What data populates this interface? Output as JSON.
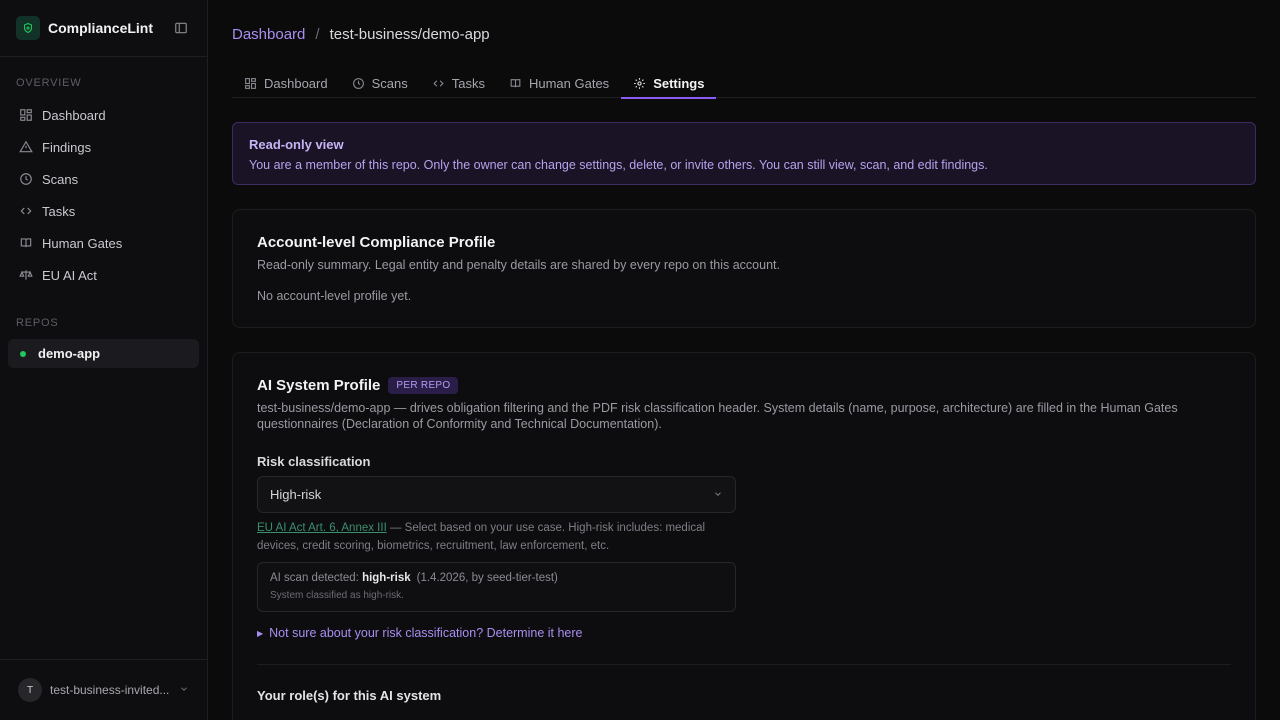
{
  "sidebar": {
    "brand": "ComplianceLint",
    "overview_label": "OVERVIEW",
    "items": [
      {
        "label": "Dashboard"
      },
      {
        "label": "Findings"
      },
      {
        "label": "Scans"
      },
      {
        "label": "Tasks"
      },
      {
        "label": "Human Gates"
      },
      {
        "label": "EU AI Act"
      }
    ],
    "repos_label": "REPOS",
    "repos": [
      {
        "label": "demo-app",
        "status_color": "#22c55e"
      }
    ],
    "user": {
      "initial": "T",
      "name": "test-business-invited..."
    }
  },
  "breadcrumb": {
    "root": "Dashboard",
    "separator": "/",
    "current": "test-business/demo-app"
  },
  "tabs": [
    {
      "label": "Dashboard"
    },
    {
      "label": "Scans"
    },
    {
      "label": "Tasks"
    },
    {
      "label": "Human Gates"
    },
    {
      "label": "Settings",
      "active": true
    }
  ],
  "notice": {
    "title": "Read-only view",
    "text": "You are a member of this repo. Only the owner can change settings, delete, or invite others. You can still view, scan, and edit findings."
  },
  "account_profile": {
    "title": "Account-level Compliance Profile",
    "subtitle": "Read-only summary. Legal entity and penalty details are shared by every repo on this account.",
    "empty": "No account-level profile yet."
  },
  "ai_profile": {
    "title": "AI System Profile",
    "badge": "PER REPO",
    "description": "test-business/demo-app — drives obligation filtering and the PDF risk classification header. System details (name, purpose, architecture) are filled in the Human Gates questionnaires (Declaration of Conformity and Technical Documentation).",
    "risk_label": "Risk classification",
    "risk_value": "High-risk",
    "hint_link": "EU AI Act Art. 6, Annex III",
    "hint_text": " — Select based on your use case. High-risk includes: medical devices, credit scoring, biometrics, recruitment, law enforcement, etc.",
    "scan_prefix": "AI scan detected: ",
    "scan_value": "high-risk",
    "scan_meta": "(1.4.2026, by seed-tier-test)",
    "scan_note": "System classified as high-risk.",
    "disclosure": "Not sure about your risk classification? Determine it here",
    "roles_title": "Your role(s) for this AI system"
  },
  "colors": {
    "accent": "#8b5cf6",
    "link": "#a98ef0",
    "success": "#22c55e"
  }
}
